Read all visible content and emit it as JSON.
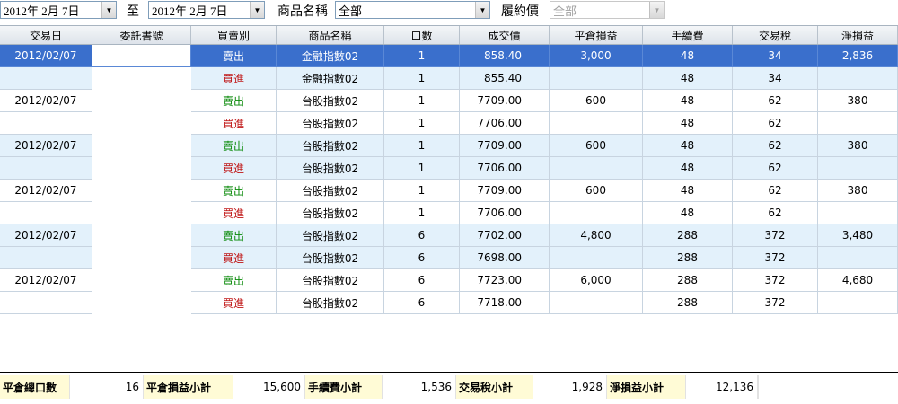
{
  "filter": {
    "date_from": "2012年  2月  7日",
    "to_label": "至",
    "date_to": "2012年  2月  7日",
    "product_label": "商品名稱",
    "product_value": "全部",
    "strike_label": "履約價",
    "strike_value": "全部",
    "dropdown_glyph": "▼"
  },
  "columns": [
    "交易日",
    "委託書號",
    "買賣別",
    "商品名稱",
    "口數",
    "成交價",
    "平倉損益",
    "手續費",
    "交易稅",
    "淨損益"
  ],
  "rows": [
    {
      "date": "2012/02/07",
      "order_id": "",
      "side": "賣出",
      "product": "金融指數02",
      "qty": "1",
      "price": "858.40",
      "pnl": "3,000",
      "fee": "48",
      "tax": "34",
      "net": "2,836"
    },
    {
      "date": "",
      "order_id": "",
      "side": "買進",
      "product": "金融指數02",
      "qty": "1",
      "price": "855.40",
      "pnl": "",
      "fee": "48",
      "tax": "34",
      "net": ""
    },
    {
      "date": "2012/02/07",
      "order_id": "",
      "side": "賣出",
      "product": "台股指數02",
      "qty": "1",
      "price": "7709.00",
      "pnl": "600",
      "fee": "48",
      "tax": "62",
      "net": "380"
    },
    {
      "date": "",
      "order_id": "",
      "side": "買進",
      "product": "台股指數02",
      "qty": "1",
      "price": "7706.00",
      "pnl": "",
      "fee": "48",
      "tax": "62",
      "net": ""
    },
    {
      "date": "2012/02/07",
      "order_id": "",
      "side": "賣出",
      "product": "台股指數02",
      "qty": "1",
      "price": "7709.00",
      "pnl": "600",
      "fee": "48",
      "tax": "62",
      "net": "380"
    },
    {
      "date": "",
      "order_id": "",
      "side": "買進",
      "product": "台股指數02",
      "qty": "1",
      "price": "7706.00",
      "pnl": "",
      "fee": "48",
      "tax": "62",
      "net": ""
    },
    {
      "date": "2012/02/07",
      "order_id": "",
      "side": "賣出",
      "product": "台股指數02",
      "qty": "1",
      "price": "7709.00",
      "pnl": "600",
      "fee": "48",
      "tax": "62",
      "net": "380"
    },
    {
      "date": "",
      "order_id": "",
      "side": "買進",
      "product": "台股指數02",
      "qty": "1",
      "price": "7706.00",
      "pnl": "",
      "fee": "48",
      "tax": "62",
      "net": ""
    },
    {
      "date": "2012/02/07",
      "order_id": "",
      "side": "賣出",
      "product": "台股指數02",
      "qty": "6",
      "price": "7702.00",
      "pnl": "4,800",
      "fee": "288",
      "tax": "372",
      "net": "3,480"
    },
    {
      "date": "",
      "order_id": "",
      "side": "買進",
      "product": "台股指數02",
      "qty": "6",
      "price": "7698.00",
      "pnl": "",
      "fee": "288",
      "tax": "372",
      "net": ""
    },
    {
      "date": "2012/02/07",
      "order_id": "",
      "side": "賣出",
      "product": "台股指數02",
      "qty": "6",
      "price": "7723.00",
      "pnl": "6,000",
      "fee": "288",
      "tax": "372",
      "net": "4,680"
    },
    {
      "date": "",
      "order_id": "",
      "side": "買進",
      "product": "台股指數02",
      "qty": "6",
      "price": "7718.00",
      "pnl": "",
      "fee": "288",
      "tax": "372",
      "net": ""
    }
  ],
  "summary": {
    "total_qty_label": "平倉總口數",
    "total_qty": "16",
    "pnl_label": "平倉損益小計",
    "pnl": "15,600",
    "fee_label": "手續費小計",
    "fee": "1,536",
    "tax_label": "交易稅小計",
    "tax": "1,928",
    "net_label": "淨損益小計",
    "net": "12,136"
  },
  "colors": {
    "selected_row": "#3a6fcc",
    "band_row": "#e3f1fb",
    "sell_text": "#0a8a0a",
    "buy_text": "#c01818",
    "summary_label_bg": "#fffbd6"
  }
}
